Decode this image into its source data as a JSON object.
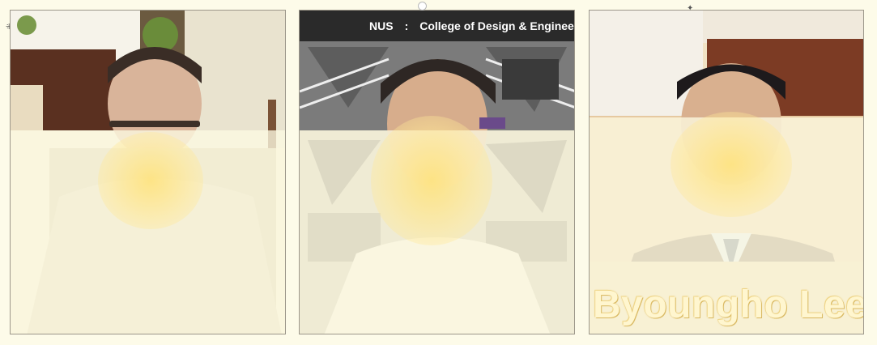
{
  "participants": [
    {
      "id": "p1"
    },
    {
      "id": "p2",
      "banner": {
        "org": "NUS",
        "separator": ":",
        "text": "College of Design & Engineeri"
      }
    },
    {
      "id": "p3",
      "name": "Byoungho Lee"
    }
  ],
  "colors": {
    "page_background": "#fdfbe9",
    "tile_border": "#9c978a",
    "banner_background": "#2a2a2a",
    "banner_text": "#ffffff",
    "name_caption": "#fff6cf"
  }
}
